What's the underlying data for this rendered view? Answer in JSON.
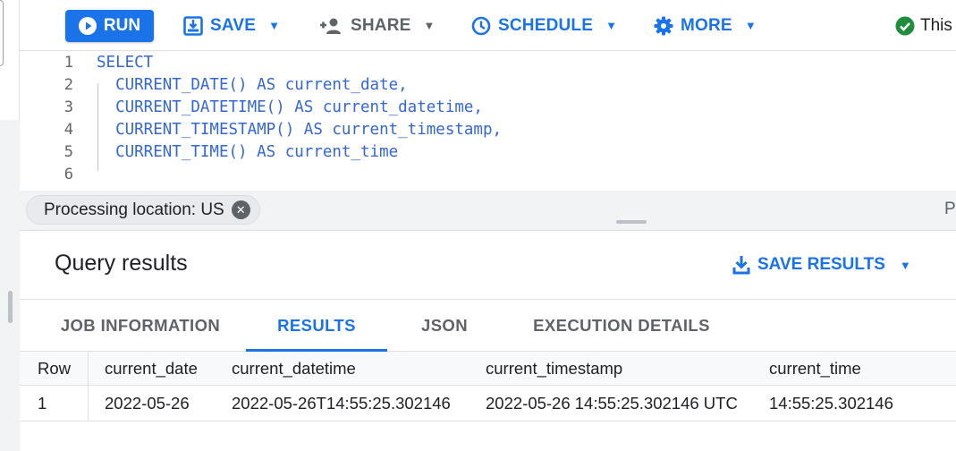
{
  "toolbar": {
    "run_label": "RUN",
    "save_label": "SAVE",
    "share_label": "SHARE",
    "schedule_label": "SCHEDULE",
    "more_label": "MORE",
    "status_text": "This"
  },
  "editor": {
    "line_numbers": [
      "1",
      "2",
      "3",
      "4",
      "5",
      "6"
    ],
    "lines": [
      "SELECT",
      "  CURRENT_DATE() AS current_date,",
      "  CURRENT_DATETIME() AS current_datetime,",
      "  CURRENT_TIMESTAMP() AS current_timestamp,",
      "  CURRENT_TIME() AS current_time",
      ""
    ]
  },
  "processing": {
    "chip_label": "Processing location: US",
    "right_cut_text": "P"
  },
  "results": {
    "title": "Query results",
    "save_results_label": "SAVE RESULTS",
    "tabs": [
      "JOB INFORMATION",
      "RESULTS",
      "JSON",
      "EXECUTION DETAILS"
    ],
    "active_tab": "RESULTS",
    "table": {
      "columns": [
        "Row",
        "current_date",
        "current_datetime",
        "current_timestamp",
        "current_time"
      ],
      "rows": [
        [
          "1",
          "2022-05-26",
          "2022-05-26T14:55:25.302146",
          "2022-05-26 14:55:25.302146 UTC",
          "14:55:25.302146"
        ]
      ]
    }
  },
  "colors": {
    "accent": "#1a73e8",
    "success": "#1e8e3e",
    "code": "#3367d6"
  }
}
